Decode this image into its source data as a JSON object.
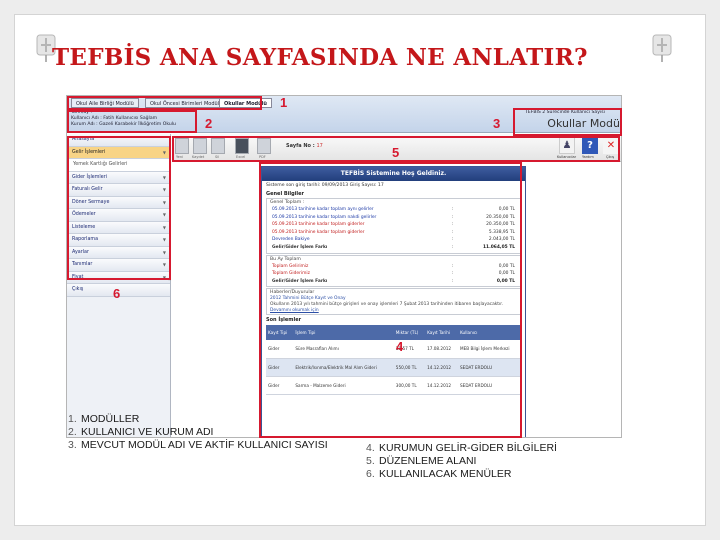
{
  "slide_title": "TEFBİS ANA SAYFASINDA NE ANLATIR?",
  "screenshot": {
    "modules": [
      "Okul Aile Birliği Modülü",
      "Okul Öncesi Birimleri Modülü",
      "Okullar Modülü"
    ],
    "user_info": [
      "Tarih/ay :",
      "Kullanıcı Adı  :  Fatih Kullanıcısı Sağlam",
      "Kurum Adı      :  Gazeli Karabekir İlköğretim Okulu"
    ],
    "institution_line": "TEFBİS 2 Sürecinde Kullanıcı Sayısı",
    "module_name": "Okullar Modü",
    "page_no_label": "Sayfa No :",
    "page_no_value": "17",
    "toolbar_labels": [
      "Yeni",
      "Kaydet",
      "Sil",
      "Excel",
      "PDF"
    ],
    "right_actions": [
      "Kullanıcılar",
      "Yardım",
      "Çıkış"
    ],
    "menu": [
      {
        "label": "Anasayfa",
        "active": false,
        "sub": false,
        "arrow": false
      },
      {
        "label": "Gelir İşlemleri",
        "active": true,
        "sub": false,
        "arrow": true
      },
      {
        "label": "Yemek Kartlığı Gelirleri",
        "active": false,
        "sub": true,
        "arrow": false
      },
      {
        "label": "Gider İşlemleri",
        "active": false,
        "sub": false,
        "arrow": true
      },
      {
        "label": "Faturalı Gelir",
        "active": false,
        "sub": false,
        "arrow": true
      },
      {
        "label": "Döner Sermaye",
        "active": false,
        "sub": false,
        "arrow": true
      },
      {
        "label": "Ödemeler",
        "active": false,
        "sub": false,
        "arrow": true
      },
      {
        "label": "Listeleme",
        "active": false,
        "sub": false,
        "arrow": true
      },
      {
        "label": "Raporlama",
        "active": false,
        "sub": false,
        "arrow": true
      },
      {
        "label": "Ayarlar",
        "active": false,
        "sub": false,
        "arrow": true
      },
      {
        "label": "Tanımlar",
        "active": false,
        "sub": false,
        "arrow": true
      },
      {
        "label": "Fiyat",
        "active": false,
        "sub": false,
        "arrow": true
      },
      {
        "label": "Çıkış",
        "active": false,
        "sub": false,
        "arrow": false
      }
    ],
    "panel_title": "TEFBİS Sistemine Hoş Geldiniz.",
    "last_login": "Sisteme son giriş tarihi: 09/09/2013 Giriş Sayısı: 17",
    "general_info_title": "Genel Bilgiler",
    "total_box_title": "Genel Toplam :",
    "general_rows": [
      {
        "label": "05.09.2013 tarihine kadar toplam aynı gelirler",
        "amount": "0,00 TL",
        "color": "blue"
      },
      {
        "label": "05.09.2013 tarihine kadar toplam nakdi gelirler",
        "amount": "20.350,00 TL",
        "color": "blue"
      },
      {
        "label": "05.09.2013 tarihine kadar toplam giderler",
        "amount": "20.350,00 TL",
        "color": "red"
      },
      {
        "label": "05.09.2013 tarihine kadar toplam giderler",
        "amount": "5.338,95 TL",
        "color": "red"
      },
      {
        "label": "Devreden Bakiye",
        "amount": "2.043,00 TL",
        "color": "blue"
      },
      {
        "label": "Gelir/Gider İşlem Farkı",
        "amount": "11.064,05 TL",
        "color": "bold"
      }
    ],
    "period_box_title": "Bu Ay Toplam",
    "period_rows": [
      {
        "label": "Toplam Gelirimiz",
        "amount": "0,00 TL",
        "color": "red"
      },
      {
        "label": "Toplam Giderimiz",
        "amount": "0,00 TL",
        "color": "red"
      },
      {
        "label": "Gelir/Gider İşlem Farkı",
        "amount": "0,00 TL",
        "color": "bold"
      }
    ],
    "announce_box_title": "Haberler/Duyurular",
    "announce_head": "2012 Tahmini Bütçe Kayıt ve Onay",
    "announce_body": "Okulların 2013 yılı tahmini bütçe girişleri ve onay işlemleri 7 Şubat 2013 tarihinden itibaren başlayacaktır.",
    "announce_link": "Devamını okumak için",
    "ops_title": "Son İşlemler",
    "ops_headers": [
      "Kayıt Tipi",
      "İşlem Tipi",
      "Miktar (TL)",
      "Kayıt Tarihi",
      "Kullanıcı"
    ],
    "ops_rows": [
      [
        "Gider",
        "Süre Masrafları Alımı",
        "30,57 TL",
        "17.08.2012",
        "MEB Bilgi İşlem Merkezi"
      ],
      [
        "Gider",
        "Elektrik/Isınma/Elektrik Mal Alım Gideri",
        "550,00 TL",
        "14.12.2012",
        "SEDAT ERDOLU"
      ],
      [
        "Gider",
        "Sarma - Malzeme Gideri",
        "300,00 TL",
        "14.12.2012",
        "SEDAT ERDOLU"
      ]
    ]
  },
  "callouts": [
    "1",
    "2",
    "3",
    "4",
    "5",
    "6"
  ],
  "legend_left": [
    {
      "n": "1.",
      "text": "MODÜLLER"
    },
    {
      "n": "2.",
      "text": "KULLANICI VE KURUM ADI"
    },
    {
      "n": "3.",
      "text": "MEVCUT MODÜL ADI VE AKTİF KULLANICI SAYISI"
    }
  ],
  "legend_right": [
    {
      "n": "4.",
      "text": "KURUMUN GELİR-GİDER BİLGİLERİ"
    },
    {
      "n": "5.",
      "text": "DÜZENLEME ALANI"
    },
    {
      "n": "6.",
      "text": "KULLANILACAK MENÜLER"
    }
  ],
  "colors": {
    "title": "#c4171a",
    "highlight": "#d6192f",
    "panel_head": "#2c4a8c"
  },
  "icons": [
    "pushpin-icon",
    "save-icon",
    "delete-icon",
    "excel-icon",
    "pdf-icon",
    "users-icon",
    "help-icon",
    "exit-icon"
  ]
}
